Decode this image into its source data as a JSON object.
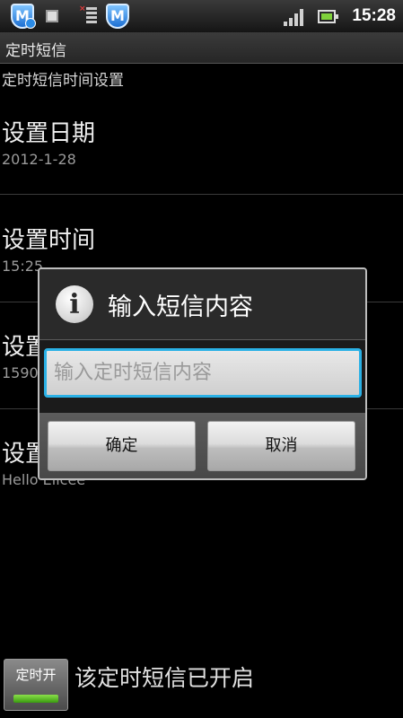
{
  "status_bar": {
    "time": "15:28",
    "icons": [
      "mcafee-m-icon",
      "chip-icon",
      "task-list-icon",
      "mcafee-m-icon",
      "signal-icon",
      "battery-icon"
    ]
  },
  "app": {
    "title": "定时短信"
  },
  "section_label": "定时短信时间设置",
  "prefs": [
    {
      "title": "设置日期",
      "summary": "2012-1-28"
    },
    {
      "title": "设置时间",
      "summary": "15:25"
    },
    {
      "title": "设置",
      "summary": "1590"
    },
    {
      "title": "设置",
      "summary": "Hello Ellcee"
    }
  ],
  "toggle": {
    "label": "定时开",
    "state_text": "该定时短信已开启"
  },
  "dialog": {
    "title": "输入短信内容",
    "input_placeholder": "输入定时短信内容",
    "input_value": "",
    "ok_label": "确定",
    "cancel_label": "取消"
  },
  "colors": {
    "accent": "#2ab1e6",
    "toggle_on": "#6fd23a",
    "background": "#000000"
  }
}
